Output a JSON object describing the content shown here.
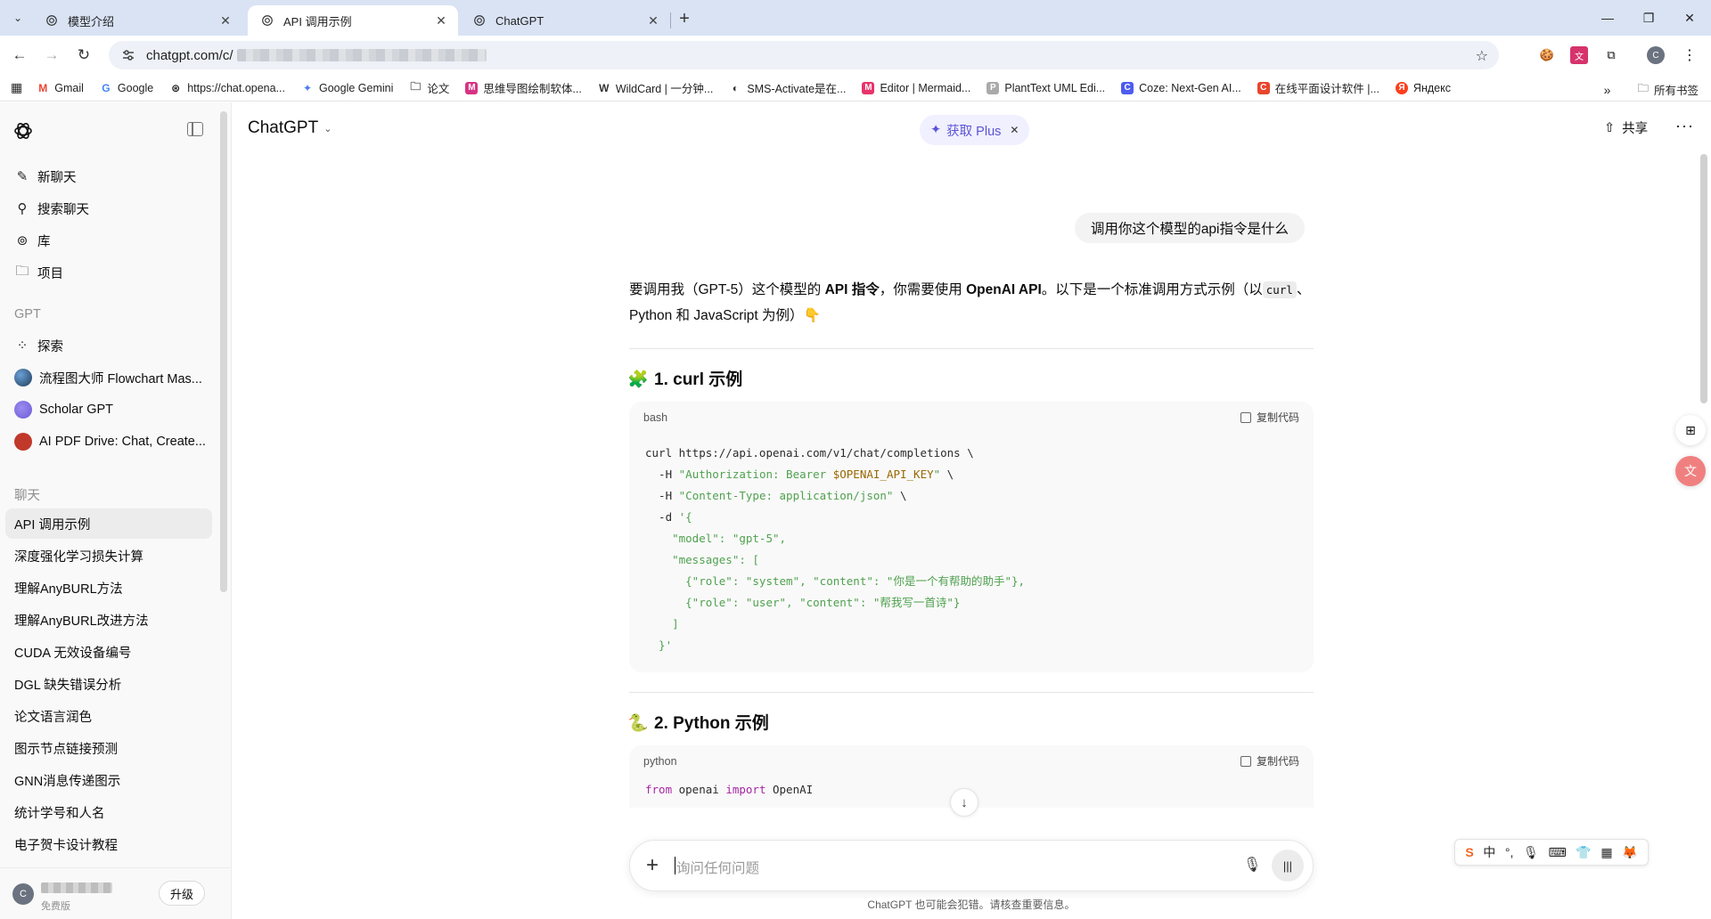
{
  "browser": {
    "tabs": [
      {
        "title": "模型介绍",
        "active": false
      },
      {
        "title": "API 调用示例",
        "active": true
      },
      {
        "title": "ChatGPT",
        "active": false
      }
    ],
    "url": "chatgpt.com/c/",
    "bookmarks": [
      {
        "label": "Gmail",
        "icon": "gmail-icon",
        "color": "#ea4335"
      },
      {
        "label": "Google",
        "icon": "google-icon",
        "color": "#4285f4"
      },
      {
        "label": "https://chat.opena...",
        "icon": "openai-icon",
        "color": "#222222"
      },
      {
        "label": "Google Gemini",
        "icon": "gemini-icon",
        "color": "#4b7bec"
      },
      {
        "label": "论文",
        "icon": "folder-icon",
        "color": "#555555"
      },
      {
        "label": "思维导图绘制软体...",
        "icon": "mindmap-icon",
        "color": "#d63384"
      },
      {
        "label": "WildCard | 一分钟...",
        "icon": "wildcard-icon",
        "color": "#333333"
      },
      {
        "label": "SMS-Activate是在...",
        "icon": "sms-icon",
        "color": "#333333"
      },
      {
        "label": "Editor | Mermaid...",
        "icon": "mermaid-icon",
        "color": "#e8336b"
      },
      {
        "label": "PlantText UML Edi...",
        "icon": "planttext-icon",
        "color": "#888888"
      },
      {
        "label": "Coze: Next-Gen AI...",
        "icon": "coze-icon",
        "color": "#4e5bf0"
      },
      {
        "label": "在线平面设计软件 |...",
        "icon": "design-icon",
        "color": "#e8452c"
      },
      {
        "label": "Яндекс",
        "icon": "yandex-icon",
        "color": "#fc3f1d"
      }
    ],
    "bookmarks_all": "所有书签"
  },
  "sidebar": {
    "top_items": [
      {
        "label": "新聊天",
        "icon": "edit-icon"
      },
      {
        "label": "搜索聊天",
        "icon": "search-icon"
      },
      {
        "label": "库",
        "icon": "library-icon"
      },
      {
        "label": "项目",
        "icon": "folder-icon"
      }
    ],
    "gpt_heading": "GPT",
    "gpt_items": [
      {
        "label": "探索",
        "icon": "grid-icon"
      },
      {
        "label": "流程图大师 Flowchart Mas...",
        "icon": "flowchart-avatar",
        "color": "#1f3b57"
      },
      {
        "label": "Scholar GPT",
        "icon": "scholar-avatar",
        "color": "#6b5bd6"
      },
      {
        "label": "AI PDF Drive: Chat, Create...",
        "icon": "pdf-avatar",
        "color": "#c0392b"
      }
    ],
    "chats_heading": "聊天",
    "chats": [
      "API 调用示例",
      "深度强化学习损失计算",
      "理解AnyBURL方法",
      "理解AnyBURL改进方法",
      "CUDA 无效设备编号",
      "DGL 缺失错误分析",
      "论文语言润色",
      "图示节点链接预测",
      "GNN消息传递图示",
      "统计学号和人名",
      "电子贺卡设计教程"
    ],
    "user": {
      "avatar_letter": "C",
      "plan": "免费版",
      "upgrade": "升级"
    }
  },
  "main": {
    "model": "ChatGPT",
    "plus_pill": "获取 Plus",
    "share": "共享",
    "user_message": "调用你这个模型的api指令是什么",
    "answer": {
      "intro_1": "要调用我（GPT-5）这个模型的 ",
      "intro_b1": "API 指令",
      "intro_2": "，你需要使用 ",
      "intro_b2": "OpenAI API",
      "intro_3": "。以下是一个标准调用方式示例（以",
      "intro_code": "curl",
      "intro_4": "、Python 和 JavaScript 为例）👇",
      "section1": "1. curl 示例",
      "section1_lang": "bash",
      "section2": "2. Python 示例",
      "section2_lang": "python",
      "copy_label": "复制代码",
      "python_first_line": "from openai import OpenAI"
    },
    "composer_placeholder": "询问任何问题",
    "disclaimer": "ChatGPT 也可能会犯错。请核查重要信息。"
  }
}
